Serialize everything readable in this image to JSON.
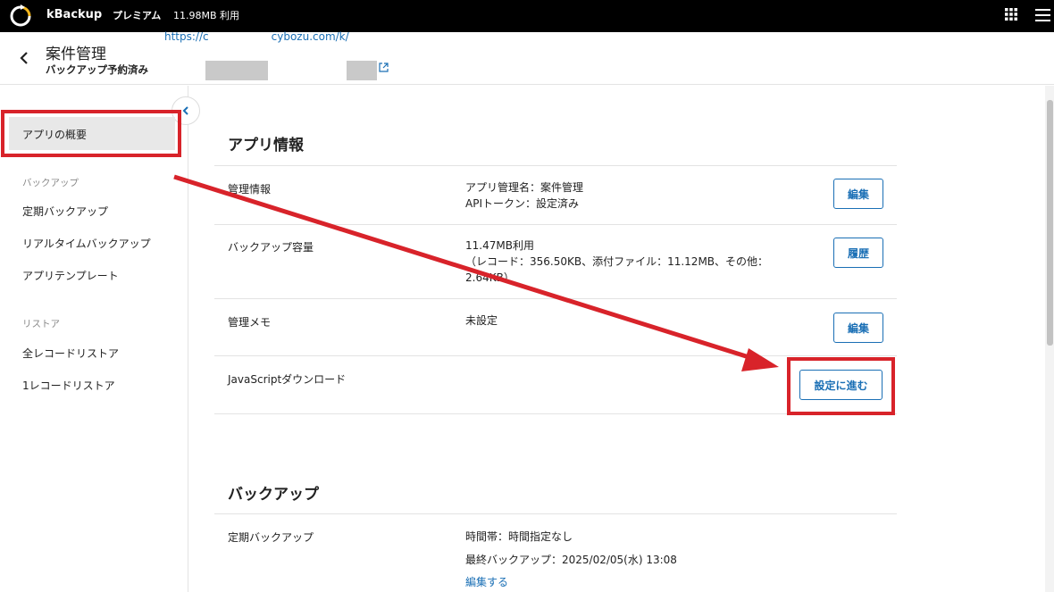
{
  "topbar": {
    "brand": "kBackup",
    "plan": "プレミアム",
    "usage": "11.98MB 利用",
    "icons": [
      "kbackup-logo-icon",
      "apps-grid-icon",
      "hamburger-menu-icon"
    ]
  },
  "header": {
    "title": "案件管理",
    "status": "バックアップ予約済み",
    "url_prefix": "https://c",
    "url_mid": "cybozu.com/k/"
  },
  "sidebar": {
    "active_item": "アプリの概要",
    "sections": [
      {
        "heading": "バックアップ",
        "items": [
          "定期バックアップ",
          "リアルタイムバックアップ",
          "アプリテンプレート"
        ]
      },
      {
        "heading": "リストア",
        "items": [
          "全レコードリストア",
          "1レコードリストア"
        ]
      }
    ]
  },
  "app_info": {
    "title": "アプリ情報",
    "rows": [
      {
        "label": "管理情報",
        "lines": [
          "アプリ管理名：案件管理",
          "APIトークン：設定済み"
        ],
        "button": "編集"
      },
      {
        "label": "バックアップ容量",
        "lines": [
          "11.47MB利用",
          "（レコード：356.50KB、添付ファイル：11.12MB、その他：",
          "2.64KB）"
        ],
        "button": "履歴"
      },
      {
        "label": "管理メモ",
        "lines": [
          "未設定"
        ],
        "button": "編集"
      },
      {
        "label": "JavaScriptダウンロード",
        "lines": [],
        "button": "設定に進む"
      }
    ]
  },
  "backup": {
    "title": "バックアップ",
    "rows": [
      {
        "label": "定期バックアップ",
        "lines": [
          "時間帯：時間指定なし",
          "最終バックアップ：2025/02/05(水) 13:08"
        ],
        "link": "編集する"
      }
    ]
  },
  "annotation_color": "#d8232a"
}
